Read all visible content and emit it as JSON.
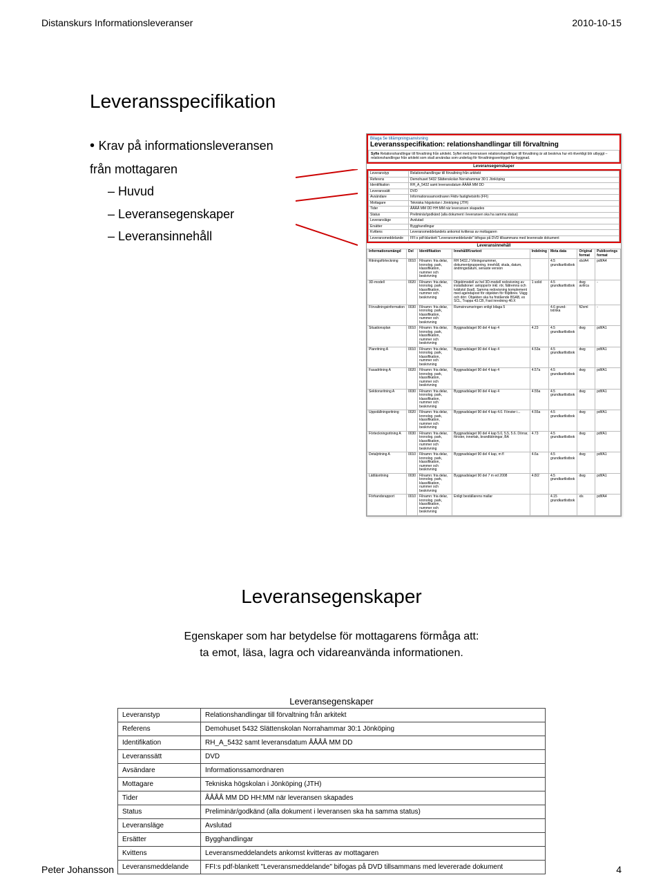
{
  "header": {
    "left": "Distanskurs Informationsleveranser",
    "right": "2010-10-15"
  },
  "footer": {
    "left": "Peter Johansson",
    "right": "4"
  },
  "slide1": {
    "title": "Leveransspecifikation",
    "bullet_main": "Krav på informationsleveransen från mottagaren",
    "sub1": "Huvud",
    "sub2": "Leveransegenskaper",
    "sub3": "Leveransinnehåll",
    "spec_head": "Bilaga 5e tillämpningsanvisning",
    "spec_title": "Leveransspecifikation: relationshandlingar till förvaltning",
    "syfte_label": "Syfte",
    "syfte_val": "Relationshandlingar till förvaltning från arkitekt. Syftet med leveransen relationshandlingar till förvaltning är att beskriva hur ett ritverkligt blir utbyggt – relationshandlingar från arkitekt som skall användas som underlag för förvaltningsverktyget för byggnad.",
    "egr_label": "Leveransegenskaper",
    "rows": [
      {
        "k": "Leveranstyp",
        "v": "Relationshandlingar till förvaltning från arkitekt"
      },
      {
        "k": "Referens",
        "v": "Demohuset 5432 Slättenskolan Norrahammar 30:1 Jönköping"
      },
      {
        "k": "Identifikation",
        "v": "RH_A_5432 samt leveransdatum ÅÅÅÅ MM DD"
      },
      {
        "k": "Leveranssätt",
        "v": "DVD"
      },
      {
        "k": "Avsändare",
        "v": "Informationssamordnaren Fiktiv fastighetsinfo (FFI)"
      },
      {
        "k": "Mottagare",
        "v": "Tekniska högskolan i Jönköping (JTH)"
      },
      {
        "k": "Tider",
        "v": "ÅÅÅÅ MM DD HH:MM när leveransen skapades"
      },
      {
        "k": "Status",
        "v": "Preliminär/godkänd (alla dokument i leveransen ska ha samma status)"
      },
      {
        "k": "Leveransläge",
        "v": "Avslutad"
      },
      {
        "k": "Ersätter",
        "v": "Bygghandlingar"
      },
      {
        "k": "Kvittens",
        "v": "Leveransmeddelandets ankomst kvitteras av mottagaren"
      },
      {
        "k": "Leveransmeddelande",
        "v": "FFI:s pdf-blankett \"Leveransmeddelande\" bifogas på DVD tillsammans med levererade dokument"
      }
    ],
    "content_label": "Leveransinnehåll",
    "content_cols": [
      "Informationsmängd",
      "Del",
      "Identifikation",
      "Innehåll/Kravtext",
      "Indelning",
      "Meta data",
      "Original format",
      "Publicerings format"
    ],
    "content_rows": [
      {
        "c": [
          "Ritningsförteckning",
          "0010",
          "Filnamn: fria delar, kronolog. park, klassifikation, nummer och beskrivning",
          "RH 5432.J Vitningsnummer, dokumentgruppering, innehåll, skala, datum, ändringsdatum, senaste version",
          "",
          "4.5 grundkartlistbok",
          "xls/A4",
          "pdf/A4"
        ]
      },
      {
        "c": [
          "3D-modell",
          "0020",
          "Filnamn: fria delar, kronolog. park, klassifikation, nummer och beskrivning",
          "Objektmodell av hel 3D-modell redovisning av installationer: avloppsrör inkl. rör, fältremns och tvättstol (bad). Samma redovisning komplement med agendapost för objekten för följdbrev. Vägg och dörr. Objekten ska ha fristående BSAB, ex SCL, Trappa 43.CB, Fast inredning 46:X",
          "1 solid",
          "4.5 grundkartlistbok",
          "dwg avilrca",
          "-"
        ]
      },
      {
        "c": [
          "Förvaltningsinformation",
          "0030",
          "Filnamn: fria delar, kronolog. park, klassifikation, nummer och beskrivning",
          "Rumsinrumsringen enligt bilaga 5",
          "",
          "4.6 grund- txt/xka",
          "fi2xml",
          "-"
        ]
      },
      {
        "c": [
          "Situationsplan",
          "0010",
          "Filnamn: fria delar, kronolog. park, klassifikation, nummer och beskrivning",
          "Byggnadslaget 90 del 4 kap 4",
          "4.23",
          "4.5 grundkartlistbok",
          "dwg",
          "pdf/A1"
        ]
      },
      {
        "c": [
          "Planritning A",
          "0010",
          "Filnamn: fria delar, kronolog. park, klassifikation, nummer och beskrivning",
          "Byggnadslaget 90 del 4 kap 4",
          "4.53a",
          "4.5 grundkartlistbok",
          "dwg",
          "pdf/A1"
        ]
      },
      {
        "c": [
          "Fasadritning A",
          "0020",
          "Filnamn: fria delar, kronolog. park, klassifikation, nummer och beskrivning",
          "Byggnadslaget 90 del 4 kap 4",
          "4.57a",
          "4.5 grundkartlistbok",
          "dwg",
          "pdf/A1"
        ]
      },
      {
        "c": [
          "Sektionsritning A",
          "0030",
          "Filnamn: fria delar, kronolog. park, klassifikation, nummer och beskrivning",
          "Byggnadslaget 90 del 4 kap 4",
          "4.55a",
          "4.5 grundkartlistbok",
          "dwg",
          "pdf/A1"
        ]
      },
      {
        "c": [
          "Uppställningsritning",
          "0020",
          "Filnamn: fria delar, kronolog. park, klassifikation, nummer och beskrivning",
          "Byggnadslaget 90 del 4 kap 4.0. Fönster i...",
          "4.55a",
          "4.5 grundkartlistbok",
          "dwg",
          "pdf/A1"
        ]
      },
      {
        "c": [
          "Förteckningsritning A",
          "0030",
          "Filnamn: fria delar, kronolog. park, klassifikation, nummer och beskrivning",
          "Byggnadslaget 90 del 4 kap 5.0, 5.5, 5.6. Dörrar, fönster, innertak, brandtätningar, BA",
          "4.73",
          "4.5 grundkartlistbok",
          "dwg",
          "pdf/A1"
        ]
      },
      {
        "c": [
          "Detaljritning A",
          "0010",
          "Filnamn: fria delar, kronolog. park, klassifikation, nummer och beskrivning",
          "Byggnadslaget 90 del 4 kap, m fl",
          "4.6a",
          "4.5 grundkartlistbok",
          "dwg",
          "pdf/A1"
        ]
      },
      {
        "c": [
          "Lättläsritning",
          "0030",
          "Filnamn: fria delar, kronolog. park, klassifikation, nummer och beskrivning",
          "Byggnadslaget 90 del 7 m ed 2008",
          "4.8/2",
          "4.5 grundkartlistbok",
          "dwg",
          "pdf/A1"
        ]
      },
      {
        "c": [
          "Förhandsrapport",
          "0010",
          "Filnamn: fria delar, kronolog. park, klassifikation, nummer och beskrivning",
          "Enligt beställarens mallar",
          "",
          "4.15 grundkartlistbok",
          "xls",
          "pdf/A4"
        ]
      }
    ]
  },
  "slide2": {
    "title": "Leveransegenskaper",
    "sub1": "Egenskaper som har betydelse för mottagarens förmåga att:",
    "sub2": "ta emot, läsa, lagra och vidareanvända informationen.",
    "table_title": "Leveransegenskaper",
    "rows": [
      {
        "k": "Leveranstyp",
        "v": "Relationshandlingar till förvaltning från arkitekt"
      },
      {
        "k": "Referens",
        "v": "Demohuset 5432 Slättenskolan Norrahammar 30:1 Jönköping"
      },
      {
        "k": "Identifikation",
        "v": "RH_A_5432 samt leveransdatum ÅÅÅÅ MM DD"
      },
      {
        "k": "Leveranssätt",
        "v": "DVD"
      },
      {
        "k": "Avsändare",
        "v": "Informationssamordnaren"
      },
      {
        "k": "Mottagare",
        "v": "Tekniska högskolan i Jönköping (JTH)"
      },
      {
        "k": "Tider",
        "v": "ÅÅÅÅ MM DD HH:MM när leveransen skapades"
      },
      {
        "k": "Status",
        "v": "Preliminär/godkänd (alla dokument i leveransen ska ha samma status)"
      },
      {
        "k": "Leveransläge",
        "v": "Avslutad"
      },
      {
        "k": "Ersätter",
        "v": "Bygghandlingar"
      },
      {
        "k": "Kvittens",
        "v": "Leveransmeddelandets ankomst kvitteras av mottagaren"
      },
      {
        "k": "Leveransmeddelande",
        "v": "FFI:s pdf-blankett \"Leveransmeddelande\" bifogas på DVD tillsammans med levererade dokument"
      }
    ]
  }
}
